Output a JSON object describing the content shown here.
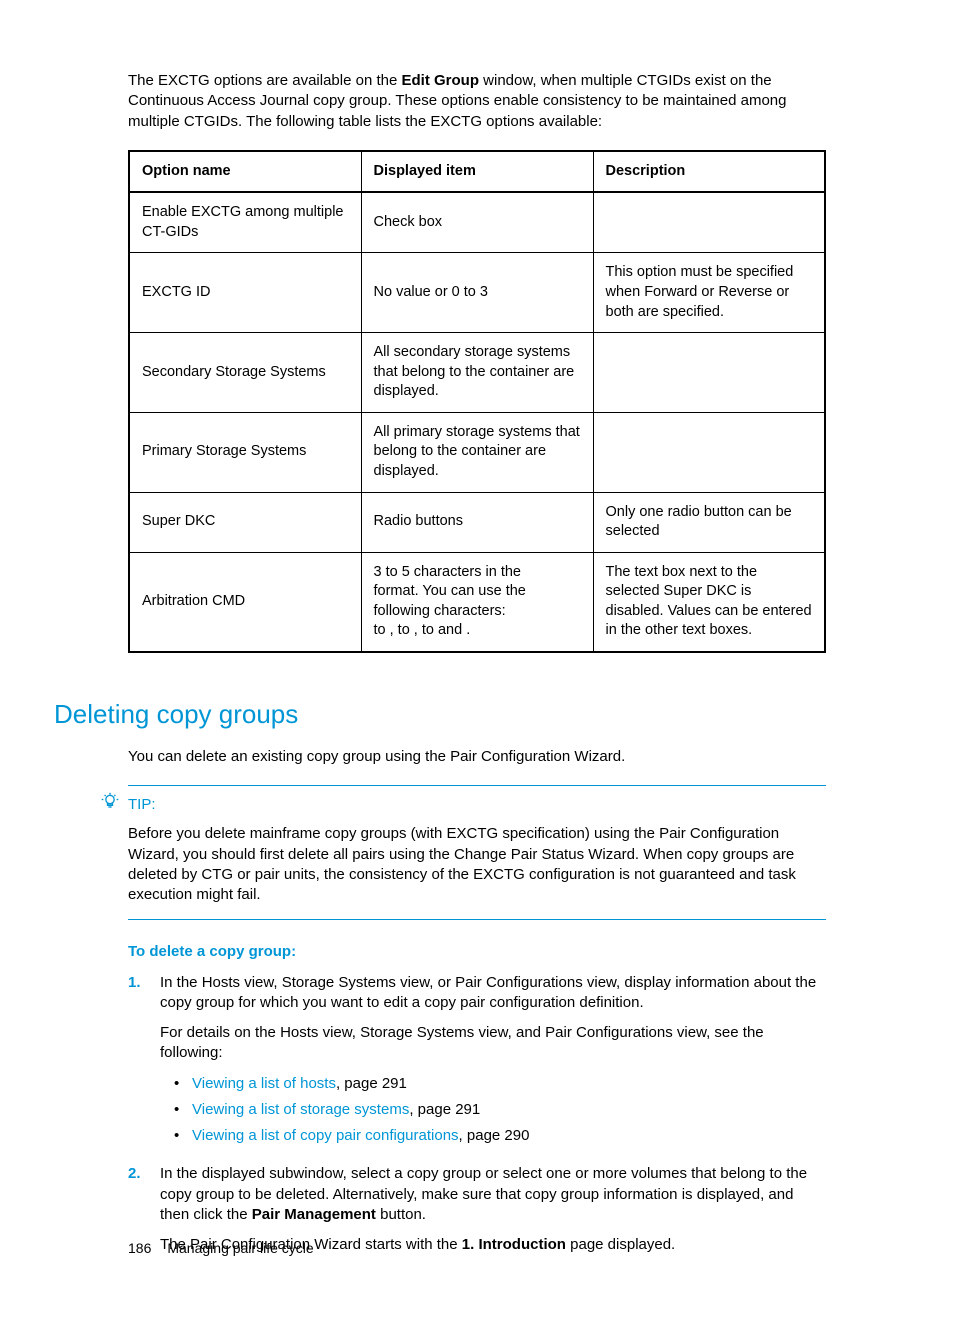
{
  "intro": {
    "part1": "The EXCTG options are available on the ",
    "bold1": "Edit Group",
    "part2": " window, when multiple CTGIDs exist on the Continuous Access Journal copy group. These options enable consistency to be maintained among multiple CTGIDs. The following table lists the EXCTG options available:"
  },
  "table": {
    "headers": {
      "c1": "Option name",
      "c2": "Displayed item",
      "c3": "Description"
    },
    "rows": [
      {
        "c1": "Enable EXCTG among multiple CT-GIDs",
        "c2": "Check box",
        "c3": ""
      },
      {
        "c1": "EXCTG ID",
        "c2": "No value or 0 to 3",
        "c3": "This option must be specified when Forward or Reverse or both are specified."
      },
      {
        "c1": "Secondary Storage Systems",
        "c2": "All secondary storage systems that belong to the container are displayed.",
        "c3": ""
      },
      {
        "c1": "Primary Storage Systems",
        "c2": "All primary storage systems that belong to the container are displayed.",
        "c3": ""
      },
      {
        "c1": "Super DKC",
        "c2": "Radio buttons",
        "c3": "Only one radio button can be selected"
      },
      {
        "c1": "Arbitration CMD",
        "c2": "3 to 5 characters in the\n                     format. You can use the following characters:\n    to   ,   to   ,   to    and   .",
        "c3": "The text box next to the selected Super DKC is disabled. Values can be entered in the other text boxes."
      }
    ]
  },
  "section_heading": "Deleting copy groups",
  "section_intro": "You can delete an existing copy group using the Pair Configuration Wizard.",
  "tip": {
    "label": "TIP:",
    "body": "Before you delete mainframe copy groups (with EXCTG specification) using the Pair Configuration Wizard, you should first delete all pairs using the Change Pair Status Wizard. When copy groups are deleted by CTG or pair units, the consistency of the EXCTG configuration is not guaranteed and task execution might fail."
  },
  "procedure_heading": "To delete a copy group:",
  "steps": [
    {
      "num": "1.",
      "p1": "In the Hosts view, Storage Systems view, or Pair Configurations view, display information about the copy group for which you want to edit a copy pair configuration definition.",
      "p2": "For details on the Hosts view, Storage Systems view, and Pair Configurations view, see the following:",
      "links": [
        {
          "text": "Viewing a list of hosts",
          "suffix": ", page 291"
        },
        {
          "text": "Viewing a list of storage systems",
          "suffix": ", page 291"
        },
        {
          "text": "Viewing a list of copy pair configurations",
          "suffix": ", page 290"
        }
      ]
    },
    {
      "num": "2.",
      "p1_a": "In the displayed subwindow, select a copy group or select one or more volumes that belong to the copy group to be deleted. Alternatively, make sure that copy group information is displayed, and then click the ",
      "p1_bold": "Pair Management",
      "p1_b": " button.",
      "p2_a": "The Pair Configuration Wizard starts with the ",
      "p2_bold": "1. Introduction",
      "p2_b": " page displayed."
    }
  ],
  "footer": {
    "page": "186",
    "chapter": "Managing pair life cycle"
  }
}
